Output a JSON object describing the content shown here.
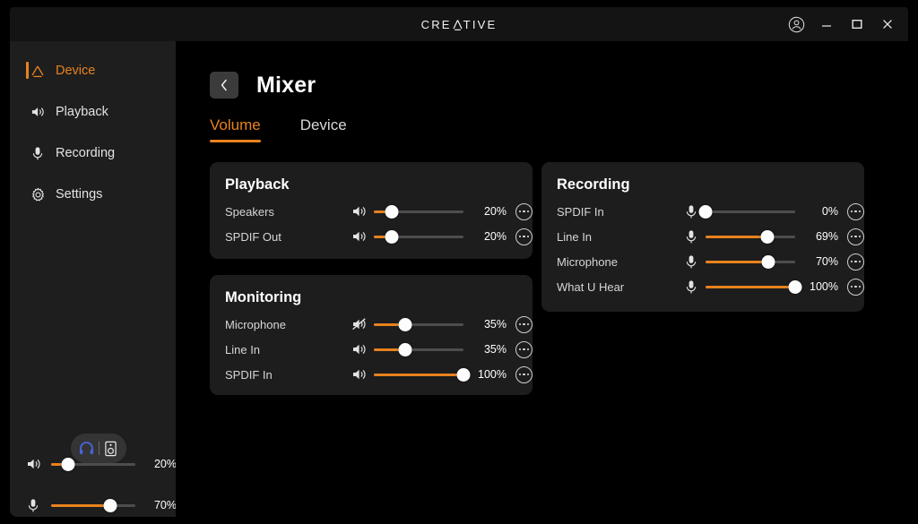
{
  "window": {
    "brand": "CREATIVE",
    "controls": {
      "account": "account-icon",
      "minimize": "minimize-icon",
      "maximize": "maximize-icon",
      "close": "close-icon"
    }
  },
  "sidebar": {
    "items": [
      {
        "label": "Device",
        "icon": "creative-triangle-icon",
        "active": true
      },
      {
        "label": "Playback",
        "icon": "speaker-icon",
        "active": false
      },
      {
        "label": "Recording",
        "icon": "microphone-icon",
        "active": false
      },
      {
        "label": "Settings",
        "icon": "gear-icon",
        "active": false
      }
    ],
    "device_toggle": {
      "headphone": "headphone-icon",
      "speaker": "speaker-box-icon",
      "selected": "headphone"
    },
    "sliders": [
      {
        "icon": "speaker-icon",
        "value": 20,
        "display": "20%"
      },
      {
        "icon": "microphone-icon",
        "value": 70,
        "display": "70%"
      }
    ]
  },
  "main": {
    "back_label": "‹",
    "title": "Mixer",
    "tabs": [
      {
        "label": "Volume",
        "active": true
      },
      {
        "label": "Device",
        "active": false
      }
    ]
  },
  "panels": {
    "playback": {
      "title": "Playback",
      "rows": [
        {
          "label": "Speakers",
          "icon": "speaker-icon",
          "value": 20,
          "display": "20%",
          "muted": false
        },
        {
          "label": "SPDIF Out",
          "icon": "speaker-icon",
          "value": 20,
          "display": "20%",
          "muted": false
        }
      ]
    },
    "monitoring": {
      "title": "Monitoring",
      "rows": [
        {
          "label": "Microphone",
          "icon": "speaker-muted-icon",
          "value": 35,
          "display": "35%",
          "muted": true
        },
        {
          "label": "Line In",
          "icon": "speaker-icon",
          "value": 35,
          "display": "35%",
          "muted": false
        },
        {
          "label": "SPDIF In",
          "icon": "speaker-icon",
          "value": 100,
          "display": "100%",
          "muted": false
        }
      ]
    },
    "recording": {
      "title": "Recording",
      "rows": [
        {
          "label": "SPDIF In",
          "icon": "microphone-icon",
          "value": 0,
          "display": "0%",
          "muted": false
        },
        {
          "label": "Line In",
          "icon": "microphone-icon",
          "value": 69,
          "display": "69%",
          "muted": false
        },
        {
          "label": "Microphone",
          "icon": "microphone-icon",
          "value": 70,
          "display": "70%",
          "muted": false
        },
        {
          "label": "What U Hear",
          "icon": "microphone-icon",
          "value": 100,
          "display": "100%",
          "muted": false
        }
      ]
    }
  },
  "colors": {
    "accent": "#e8821e",
    "panel_bg": "#1d1d1d",
    "sidebar_bg": "#1e1e1e",
    "page_bg": "#000000",
    "track": "#4d4d4d",
    "thumb": "#fdfdfd",
    "headphone_active": "#4a63d6"
  }
}
